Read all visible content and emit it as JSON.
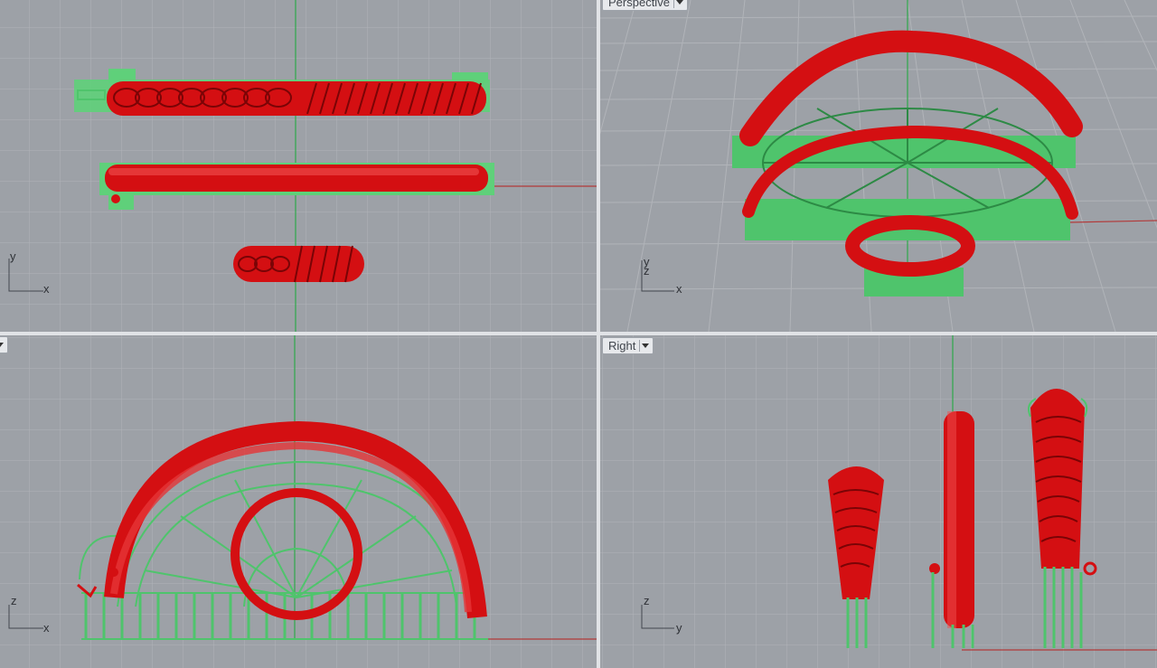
{
  "app": {
    "title": ""
  },
  "viewports": {
    "top": {
      "label": ""
    },
    "perspective": {
      "label": "Perspective"
    },
    "front": {
      "label": "ght"
    },
    "right": {
      "label": "Right"
    }
  },
  "axes": {
    "top": {
      "vertical": "y",
      "horizontal": "x"
    },
    "perspective": {
      "vertical": "y",
      "vertical2": "z",
      "horizontal": "x"
    },
    "front": {
      "vertical": "z",
      "horizontal": "x"
    },
    "right": {
      "vertical": "z",
      "horizontal": "y"
    }
  },
  "colors": {
    "grid_bg": "#9da1a7",
    "grid_line": "#b1b4b9",
    "grid_line_major": "#c3c6ca",
    "model_red": "#d40f12",
    "model_red_dark": "#8e0608",
    "support_green": "#4fc46c",
    "axis_green": "#2fa84a",
    "axis_red": "#b23a3a"
  }
}
